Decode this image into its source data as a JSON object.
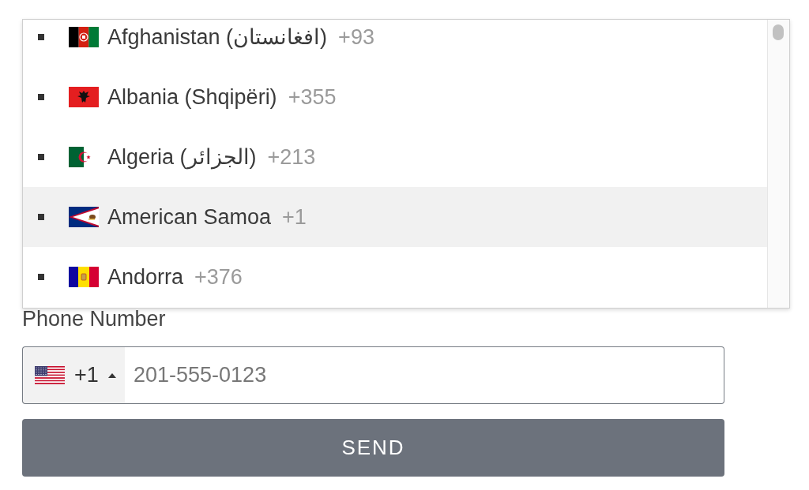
{
  "country_list": {
    "options": [
      {
        "name": "Afghanistan (افغانستان)",
        "dial_code": "+93",
        "highlighted": false
      },
      {
        "name": "Albania (Shqipëri)",
        "dial_code": "+355",
        "highlighted": false
      },
      {
        "name": "Algeria (الجزائر)",
        "dial_code": "+213",
        "highlighted": false
      },
      {
        "name": "American Samoa",
        "dial_code": "+1",
        "highlighted": true
      },
      {
        "name": "Andorra",
        "dial_code": "+376",
        "highlighted": false
      }
    ]
  },
  "phone": {
    "label": "Phone Number",
    "country_selector": {
      "dial_code": "+1",
      "expanded": true
    },
    "placeholder": "201-555-0123"
  },
  "send_button": {
    "label": "SEND"
  }
}
